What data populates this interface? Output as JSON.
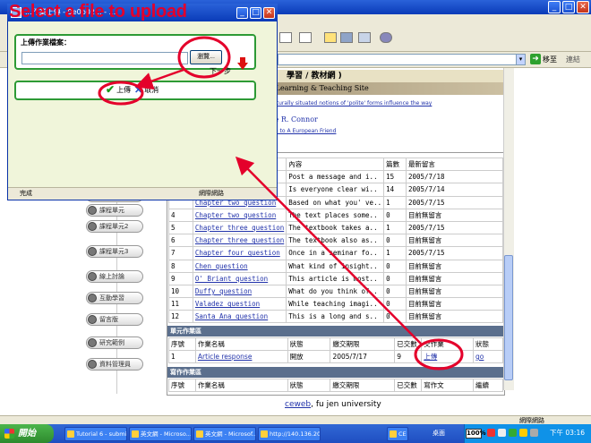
{
  "annotation": {
    "title": "Select a file to upload",
    "color": "#e4002b"
  },
  "popup": {
    "title_text": "...作業上傳 - 9e0b02... - ...",
    "upload_label": "上傳作業檔案：",
    "file_value": "",
    "browse_label": "瀏覽...",
    "next_step": "下一步",
    "submit_label": "上傳",
    "cancel_label": "取消",
    "status_done": "完成",
    "status_zone": "網際網路"
  },
  "browser": {
    "go_label": "移至",
    "links_label": "連結",
    "status_zone": "網際網路"
  },
  "site": {
    "header1": "學習 / 教材網 )",
    "header2": "h Learning & Teaching Site",
    "news1": "culturally situated notions of 'polite' forms influence the way",
    "news_author": "le R. Connor",
    "news2": "nse to A European Friend"
  },
  "menu": [
    "課程單元",
    "課程單元",
    "課程單元2",
    "課程單元3",
    "線上討論",
    "互動學習",
    "留言版",
    "研究範例",
    "資料管理員"
  ],
  "topic_table": {
    "headers": [
      "",
      "",
      "內容",
      "篇數",
      "最新留言"
    ],
    "rows": [
      [
        "",
        "",
        "Post a message and i..",
        "15",
        "2005/7/18"
      ],
      [
        "",
        "",
        "Is everyone clear wi..",
        "14",
        "2005/7/14"
      ],
      [
        "",
        "Chapter two question",
        "Based on what you' ve..",
        "1",
        "2005/7/15"
      ],
      [
        "4",
        "Chapter two question",
        "The text places some..",
        "0",
        "目前無留言"
      ],
      [
        "5",
        "Chapter three question",
        "The textbook takes a..",
        "1",
        "2005/7/15"
      ],
      [
        "6",
        "Chapter three question",
        "The textbook also as..",
        "0",
        "目前無留言"
      ],
      [
        "7",
        "Chapter four question",
        "Once in a seminar fo..",
        "1",
        "2005/7/15"
      ],
      [
        "8",
        "Chen question",
        "What kind of insight..",
        "0",
        "目前無留言"
      ],
      [
        "9",
        "O' Briant question",
        "This article is most..",
        "0",
        "目前無留言"
      ],
      [
        "10",
        "Duffy question",
        "What do you think of..",
        "0",
        "目前無留言"
      ],
      [
        "11",
        "Valadez question",
        "While teaching imagi..",
        "0",
        "目前無留言"
      ],
      [
        "12",
        "Santa Ana question",
        "This is a long and s..",
        "0",
        "目前無留言"
      ]
    ]
  },
  "unit_hw": {
    "section_title": "單元作業區",
    "headers": [
      "序號",
      "作業名稱",
      "狀態",
      "繳交期限",
      "已交數",
      "交作業",
      "狀態"
    ],
    "row": [
      "1",
      "Article response",
      "開放",
      "2005/7/17",
      "9",
      "上傳",
      "go"
    ]
  },
  "essay": {
    "section_title": "寫作作業區",
    "headers": [
      "序號",
      "作業名稱",
      "狀態",
      "繳交期限",
      "已交數",
      "寫作文",
      "繼續"
    ]
  },
  "footer": {
    "link": "ceweb",
    "suffix": ", fu jen university"
  },
  "taskbar": {
    "start": "開始",
    "tasks": [
      "Tutorial 6 - submit...",
      "英文網 - Microso...",
      "英文網 - Microsof...",
      "http://140.136.202....",
      "CE"
    ],
    "tray_label": "桌面",
    "tray_percent": "100%",
    "time": "下午 03:16"
  }
}
